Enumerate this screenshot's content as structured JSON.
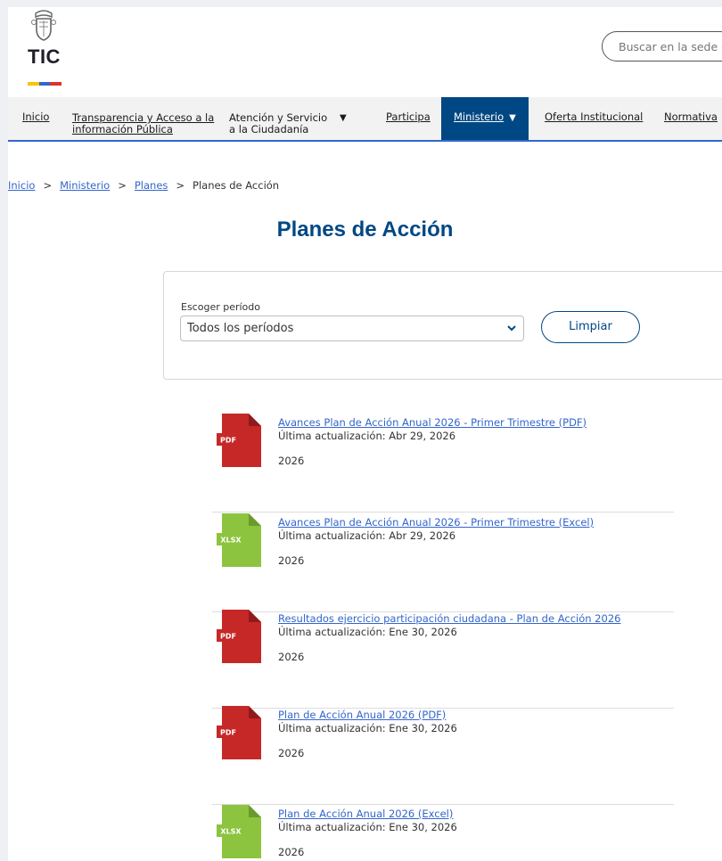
{
  "header": {
    "logo_text": "TIC",
    "logo_bar_colors": [
      "#f7c600",
      "#3366cc",
      "#e03030"
    ],
    "search_placeholder": "Buscar en la sede el"
  },
  "nav": {
    "items": [
      {
        "label": "Inicio"
      },
      {
        "label": "Transparencia y Acceso a la información Pública"
      },
      {
        "label": "Atención y Servicio a la Ciudadanía",
        "dropdown": true
      },
      {
        "label": "Participa"
      },
      {
        "label": "Ministerio",
        "dropdown": true,
        "active": true
      },
      {
        "label": "Oferta Institucional"
      },
      {
        "label": "Normativa"
      }
    ]
  },
  "breadcrumb": {
    "items": [
      "Inicio",
      "Ministerio",
      "Planes"
    ],
    "separator": ">",
    "current": "Planes de Acción"
  },
  "page_title": "Planes de Acción",
  "filter": {
    "label": "Escoger período",
    "selected": "Todos los períodos",
    "clear_label": "Limpiar"
  },
  "colors": {
    "brand": "#004884",
    "link": "#3366cc",
    "pdf": "#c62828",
    "xlsx": "#8cc43f"
  },
  "documents": [
    {
      "type": "PDF",
      "title": "Avances Plan de Acción Anual 2026 - Primer Trimestre (PDF)",
      "updated": "Última actualización: Abr 29, 2026",
      "year": "2026"
    },
    {
      "type": "XLSX",
      "title": "Avances Plan de Acción Anual 2026 - Primer Trimestre (Excel)",
      "updated": "Última actualización: Abr 29, 2026",
      "year": "2026"
    },
    {
      "type": "PDF",
      "title": "Resultados ejercicio participación ciudadana - Plan de Acción 2026",
      "updated": "Última actualización: Ene 30, 2026",
      "year": "2026"
    },
    {
      "type": "PDF",
      "title": "Plan de Acción Anual 2026 (PDF)",
      "updated": "Última actualización: Ene 30, 2026",
      "year": "2026"
    },
    {
      "type": "XLSX",
      "title": "Plan de Acción Anual 2026 (Excel)",
      "updated": "Última actualización: Ene 30, 2026",
      "year": "2026"
    }
  ]
}
